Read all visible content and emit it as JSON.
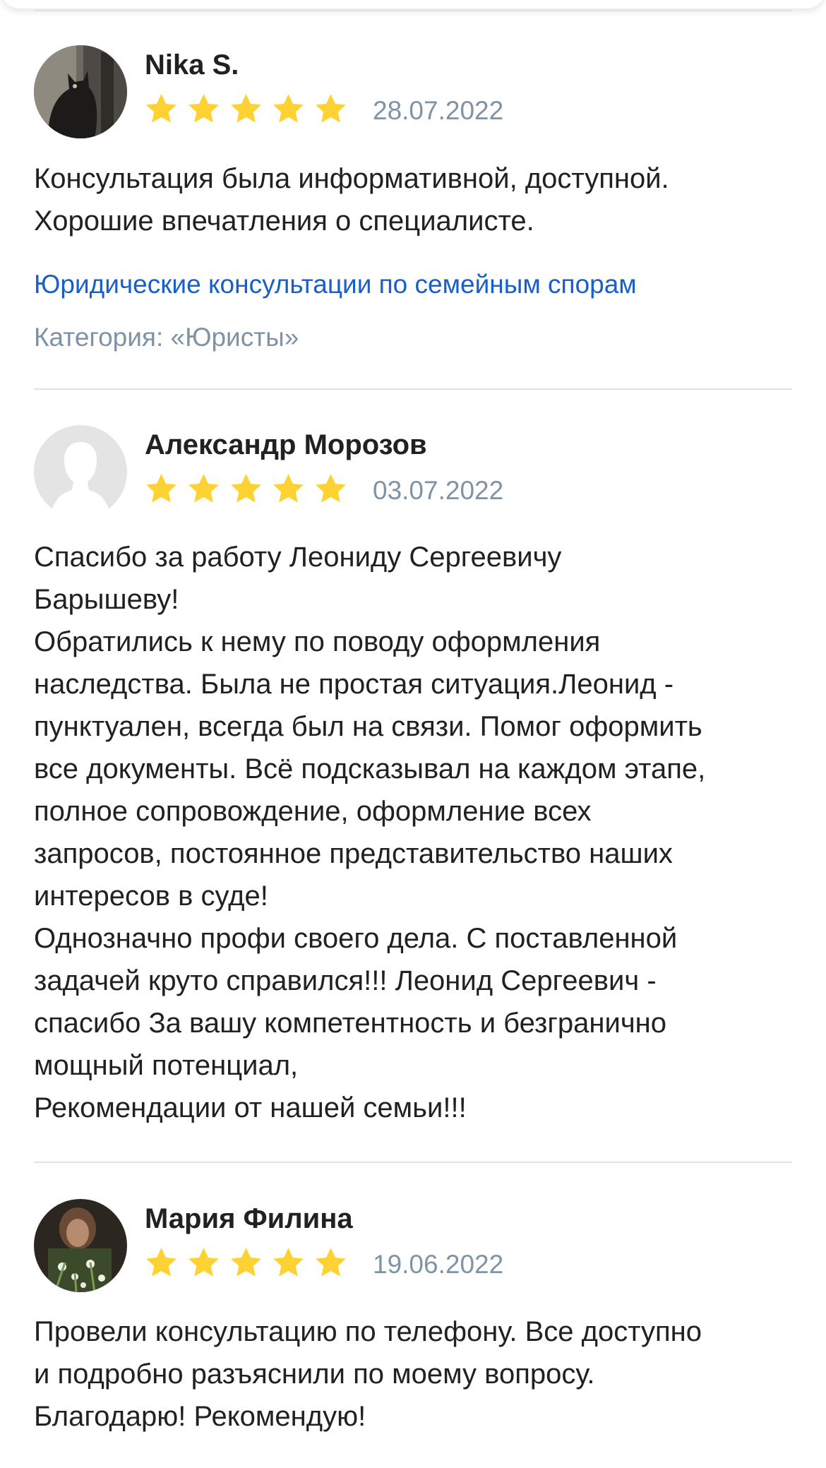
{
  "reviews": [
    {
      "name": "Nika S.",
      "avatar": "cat-photo-avatar",
      "rating": 5,
      "date": "28.07.2022",
      "text": "Консультация была информативной, доступной.\nХорошие впечатления о специалисте.",
      "service_link": "Юридические консультации по семейным спорам",
      "category": "Категория: «Юристы»"
    },
    {
      "name": "Александр Морозов",
      "avatar": "default-user-avatar",
      "rating": 5,
      "date": "03.07.2022",
      "text": "Спасибо за работу Леониду Сергеевичу\nБарышеву!\nОбратились к нему по поводу оформления\nнаследства. Была не простая ситуация.Леонид -\nпунктуален, всегда был на связи. Помог оформить\nвсе документы. Всё подсказывал на каждом этапе,\nполное сопровождение, оформление всех\nзапросов, постоянное представительство наших\nинтересов в суде!\nОднозначно профи своего дела. С поставленной\nзадачей круто справился!!! Леонид Сергеевич -\nспасибо За вашу компетентность и безгранично\nмощный потенциал,\nРекомендации от нашей семьи!!!"
    },
    {
      "name": "Мария Филина",
      "avatar": "flowers-photo-avatar",
      "rating": 5,
      "date": "19.06.2022",
      "text": "Провели консультацию по телефону. Все доступно\nи подробно разъяснили по моему вопросу.\nБлагодарю! Рекомендую!"
    }
  ],
  "colors": {
    "star": "#ffd233",
    "link": "#1a5fc7",
    "muted": "#7f93a6",
    "divider": "#dfe3e8"
  }
}
